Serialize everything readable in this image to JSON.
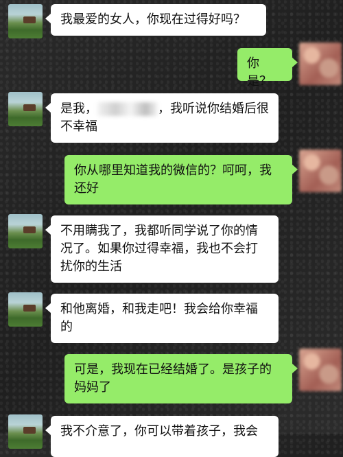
{
  "messages": [
    {
      "side": "left",
      "text": "我最爱的女人，你现在过得好吗？"
    },
    {
      "side": "right",
      "text": "你是？"
    },
    {
      "side": "left",
      "text_a": "是我，",
      "text_b": "，我听说你结婚后很不幸福"
    },
    {
      "side": "right",
      "text": "你从哪里知道我的微信的？呵呵，我还好"
    },
    {
      "side": "left",
      "text": "不用瞒我了，我都听同学说了你的情况了。如果你过得幸福，我也不会打扰你的生活"
    },
    {
      "side": "left",
      "text": "和他离婚，和我走吧！我会给你幸福的"
    },
    {
      "side": "right",
      "text": "可是，我现在已经结婚了。是孩子的妈妈了"
    },
    {
      "side": "left",
      "text": "我不介意了，你可以带着孩子，我会"
    }
  ],
  "colors": {
    "incoming_bubble": "#ffffff",
    "outgoing_bubble": "#95ec69",
    "background": "#242424"
  },
  "icons": {
    "friend_avatar": "landscape-avatar-icon",
    "self_avatar": "blurred-avatar-icon"
  }
}
